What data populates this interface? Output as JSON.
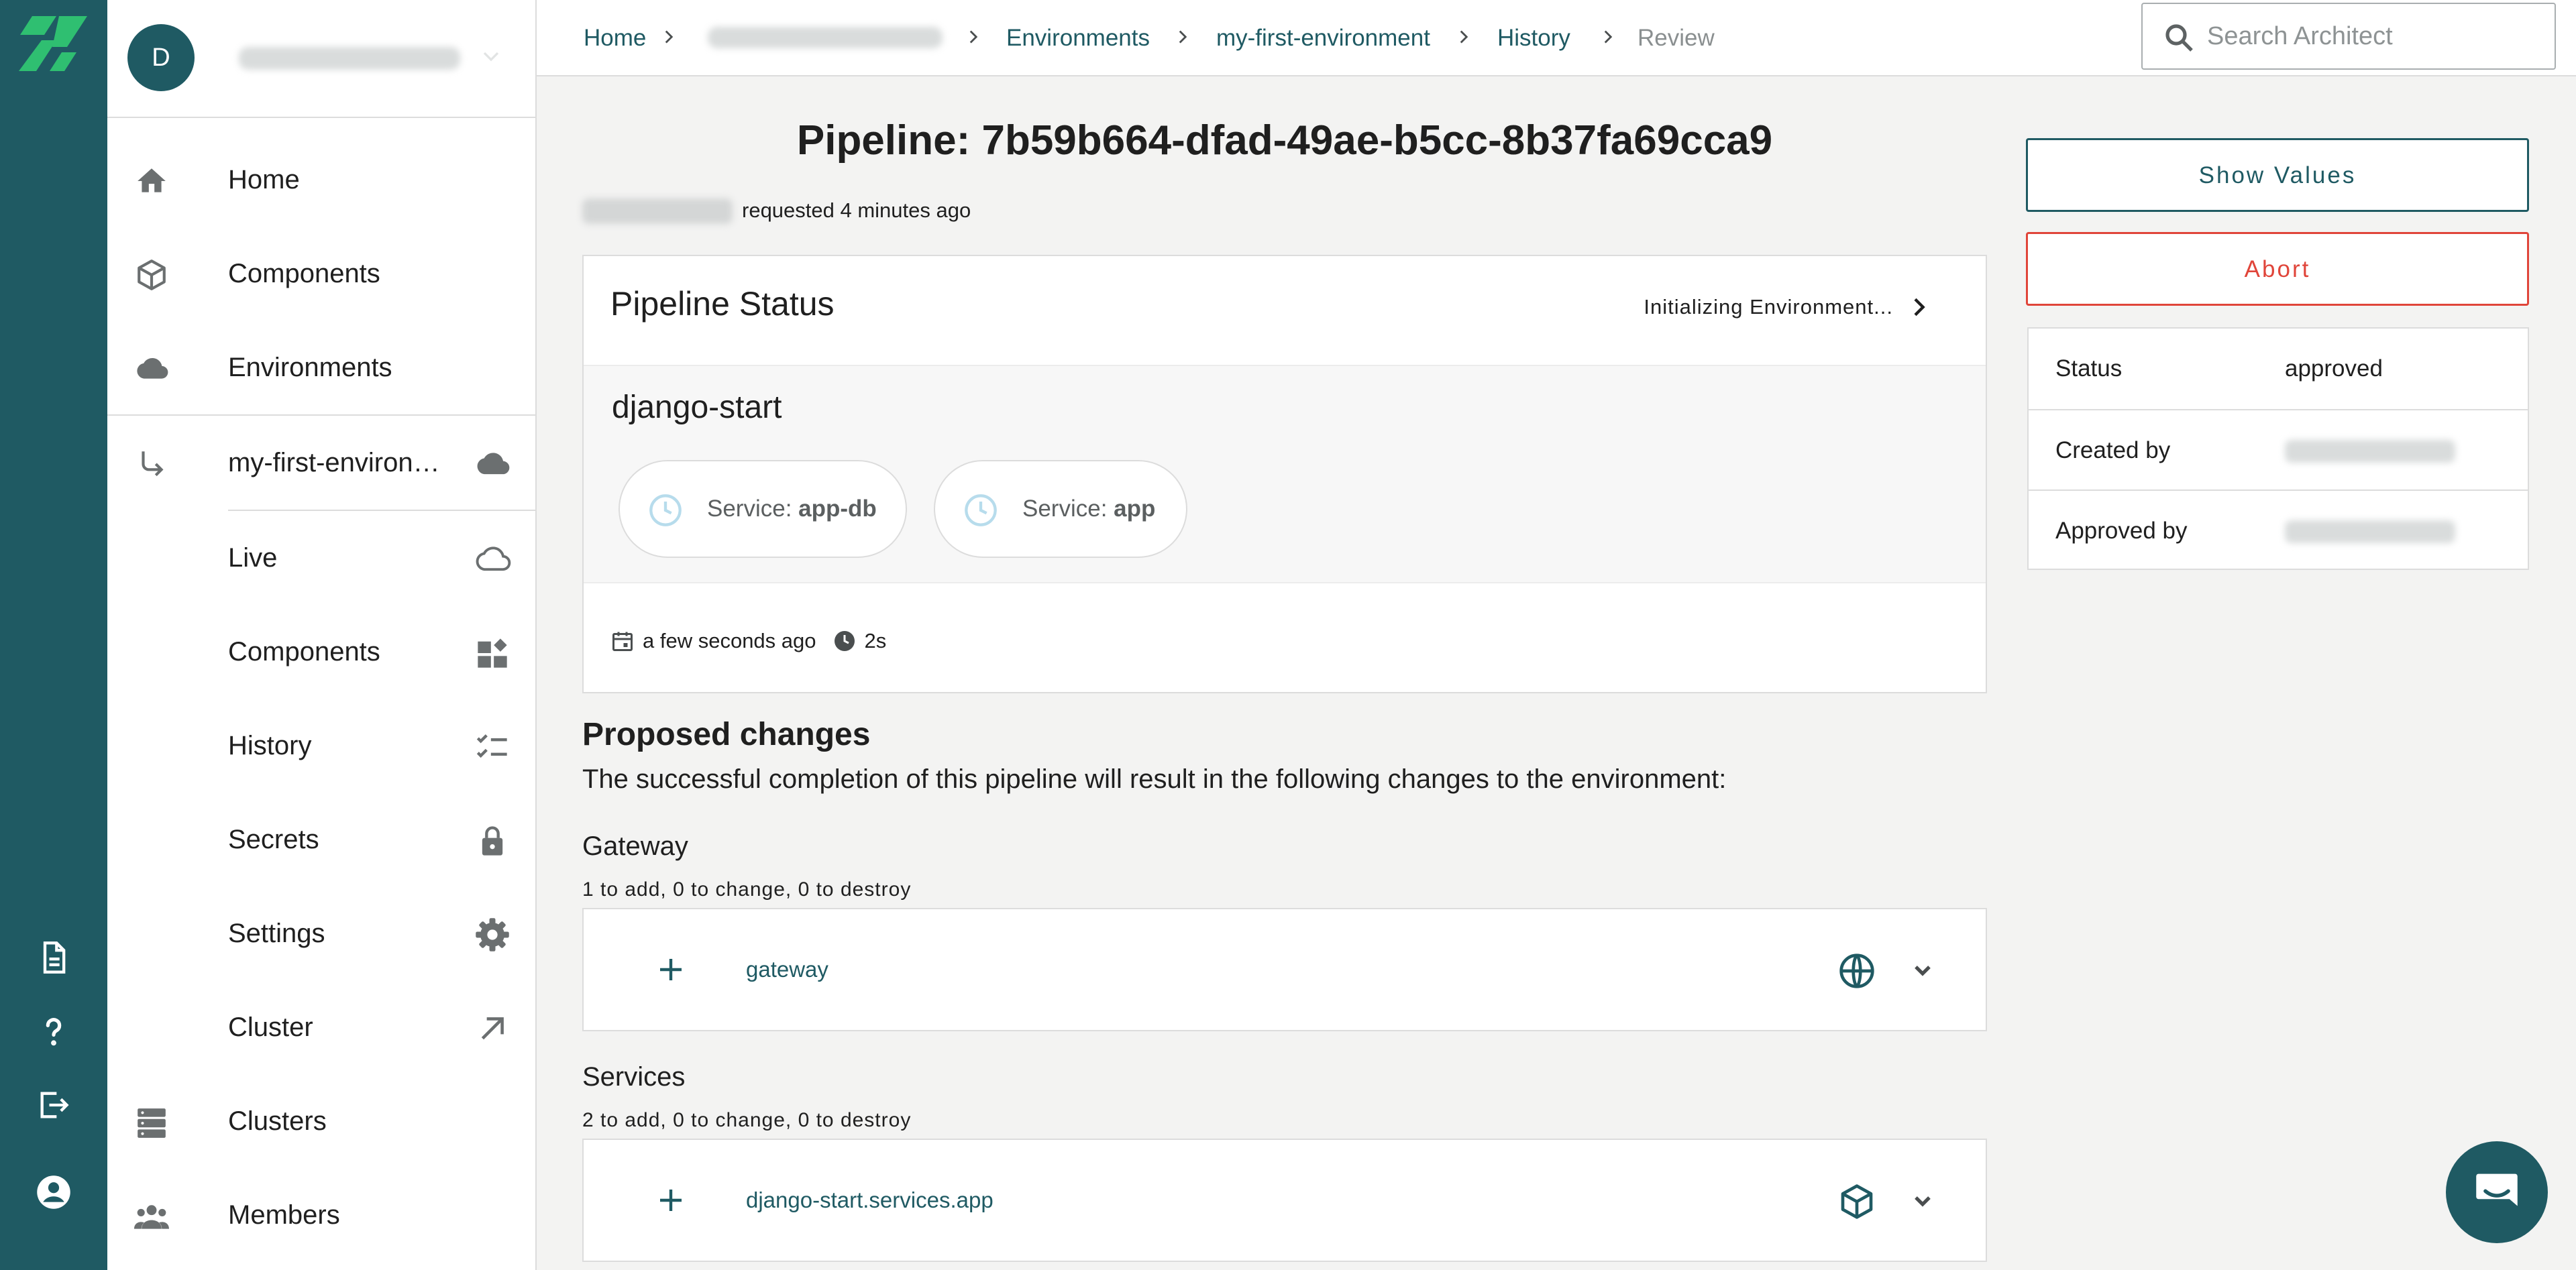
{
  "colors": {
    "brand": "#1f5a63",
    "logo": "#2fbf71",
    "danger": "#e0453a",
    "chip_icon": "#b7dcec",
    "page_background": "#f3f3f2"
  },
  "account": {
    "avatar_initial": "D"
  },
  "sidebar": {
    "items": [
      {
        "label": "Home",
        "icon": "home-icon"
      },
      {
        "label": "Components",
        "icon": "cube-outline-icon"
      },
      {
        "label": "Environments",
        "icon": "cloud-icon"
      }
    ],
    "environment": {
      "label": "my-first-environ…",
      "icon": "subdirectory-arrow-icon",
      "status_icon": "cloud-icon"
    },
    "environment_items": [
      {
        "label": "Live",
        "icon": "cloud-outline-icon"
      },
      {
        "label": "Components",
        "icon": "dashboard-icon"
      },
      {
        "label": "History",
        "icon": "checklist-icon"
      },
      {
        "label": "Secrets",
        "icon": "lock-icon"
      },
      {
        "label": "Settings",
        "icon": "gear-icon"
      },
      {
        "label": "Cluster",
        "icon": "arrow-up-right-icon"
      }
    ],
    "bottom_items": [
      {
        "label": "Clusters",
        "icon": "server-icon"
      },
      {
        "label": "Members",
        "icon": "group-icon"
      }
    ]
  },
  "rail": {
    "icons": [
      "logo-icon",
      "document-icon",
      "help-icon",
      "logout-icon",
      "account-circle-icon"
    ]
  },
  "breadcrumb": {
    "items": [
      {
        "label": "Home"
      },
      {
        "label": "Environments"
      },
      {
        "label": "my-first-environment"
      },
      {
        "label": "History"
      },
      {
        "label": "Review"
      }
    ]
  },
  "search": {
    "placeholder": "Search Architect",
    "value": ""
  },
  "pipeline": {
    "title": "Pipeline: 7b59b664-dfad-49ae-b5cc-8b37fa69cca9",
    "requested": "requested 4 minutes ago",
    "status_card": {
      "title": "Pipeline Status",
      "state": "Initializing Environment...",
      "stage": "django-start",
      "services": [
        {
          "prefix": "Service:",
          "name": "app-db"
        },
        {
          "prefix": "Service:",
          "name": "app"
        }
      ],
      "started": "a few seconds ago",
      "duration": "2s"
    }
  },
  "changes": {
    "title": "Proposed changes",
    "description": "The successful completion of this pipeline will result in the following changes to the environment:",
    "groups": [
      {
        "title": "Gateway",
        "summary": "1 to add, 0 to change, 0 to destroy",
        "items": [
          {
            "action": "add",
            "name": "gateway",
            "type_icon": "globe-icon"
          }
        ]
      },
      {
        "title": "Services",
        "summary": "2 to add, 0 to change, 0 to destroy",
        "items": [
          {
            "action": "add",
            "name": "django-start.services.app",
            "type_icon": "cube-outline-icon"
          }
        ]
      }
    ]
  },
  "actions": {
    "show_values": "Show Values",
    "abort": "Abort"
  },
  "info": {
    "status_label": "Status",
    "status_value": "approved",
    "created_by_label": "Created by",
    "approved_by_label": "Approved by"
  },
  "chat": {
    "icon": "chat-icon"
  }
}
